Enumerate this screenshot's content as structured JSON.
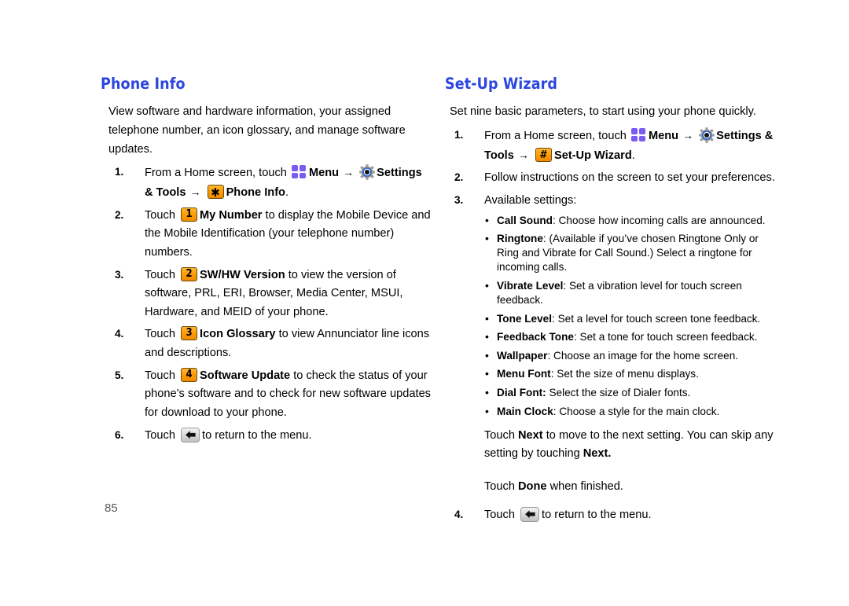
{
  "page": {
    "number": "85"
  },
  "left": {
    "heading": "Phone Info",
    "intro": "View software and hardware information, your assigned telephone number, an icon glossary, and manage software updates.",
    "steps": [
      {
        "num": "1.",
        "p1": "From a Home screen, touch",
        "menu_label": "Menu",
        "arrow": "→",
        "settings_label": "Settings &",
        "tools_label": "Tools",
        "arrow2": "→",
        "key_glyph": "✱",
        "target_label": "Phone Info",
        "period": "."
      },
      {
        "num": "2.",
        "p1": "Touch",
        "key_glyph": "1",
        "bold": "My Number",
        "p2": "to display the Mobile Device and the Mobile Identification (your telephone number) numbers."
      },
      {
        "num": "3.",
        "p1": "Touch",
        "key_glyph": "2",
        "bold": "SW/HW Version",
        "p2": "to view the version of software, PRL, ERI, Browser, Media Center, MSUI, Hardware, and MEID of your phone."
      },
      {
        "num": "4.",
        "p1": "Touch",
        "key_glyph": "3",
        "bold": "Icon Glossary",
        "p2": "to view Annunciator line icons and descriptions."
      },
      {
        "num": "5.",
        "p1": "Touch",
        "key_glyph": "4",
        "bold": "Software Update",
        "p2": "to check the status of your phone’s software and to check for new software updates for download to your phone."
      },
      {
        "num": "6.",
        "p1": "Touch",
        "p2": "to return to the menu."
      }
    ]
  },
  "right": {
    "heading": "Set-Up Wizard",
    "intro": "Set nine basic parameters, to start using your phone quickly.",
    "step1": {
      "num": "1.",
      "p1": "From a Home screen, touch",
      "menu_label": "Menu",
      "arrow": "→",
      "settings_label": "Settings &",
      "tools_label": "Tools",
      "arrow2": "→",
      "key_glyph": "#",
      "target_label": "Set-Up Wizard",
      "period": "."
    },
    "step2": {
      "num": "2.",
      "text": "Follow instructions on the screen to set your preferences."
    },
    "step3": {
      "num": "3.",
      "text": "Available settings:"
    },
    "settings": [
      {
        "term": "Call Sound",
        "sep": ": ",
        "desc": "Choose how incoming calls are announced."
      },
      {
        "term": "Ringtone",
        "sep": ":  ",
        "desc": "(Available if you’ve chosen Ringtone Only or Ring and Vibrate for Call Sound.) Select a ringtone for incoming calls."
      },
      {
        "term": "Vibrate Level",
        "sep": ": ",
        "desc": "Set a vibration level for touch screen feedback."
      },
      {
        "term": "Tone Level",
        "sep": ": ",
        "desc": "Set a level for touch screen tone feedback."
      },
      {
        "term": "Feedback Tone",
        "sep": ": ",
        "desc": "Set a tone for touch screen feedback."
      },
      {
        "term": "Wallpaper",
        "sep": ": ",
        "desc": "Choose an image for the home screen."
      },
      {
        "term": "Menu Font",
        "sep": ": ",
        "desc": "Set the size of menu displays."
      },
      {
        "term": "Dial Font:",
        "sep": " ",
        "desc": "Select the size of Dialer fonts."
      },
      {
        "term": "Main Clock",
        "sep": ": ",
        "desc": "Choose a style for the main clock."
      }
    ],
    "next_para": {
      "p1": "Touch",
      "b1": "Next",
      "p2": "to move to the next setting. You can skip any setting by touching",
      "b2": "Next."
    },
    "done_para": {
      "p1": "Touch",
      "b1": "Done",
      "p2": "when finished."
    },
    "step4": {
      "num": "4.",
      "p1": "Touch",
      "p2": "to return to the menu."
    }
  },
  "icons": {
    "menu": "menu-grid-icon",
    "gear": "settings-gear-icon",
    "key": "keypad-key-icon",
    "back": "back-arrow-icon"
  },
  "colors": {
    "heading": "#2b46e0",
    "menu_tile": "#7b5cf0",
    "key_orange": "#ff9d06",
    "gear_ring": "#1f5fd0"
  }
}
